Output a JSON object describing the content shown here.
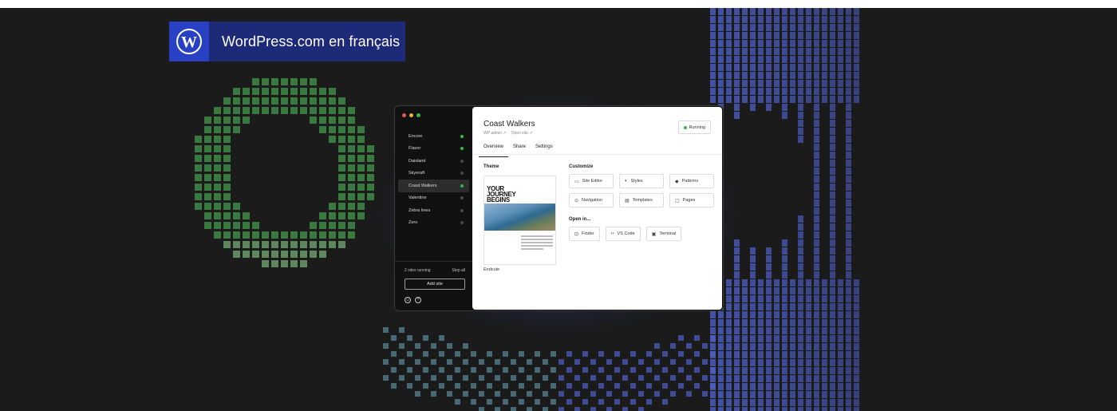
{
  "brand": {
    "title": "WordPress.com en français",
    "logo_icon": "wordpress-logo-icon",
    "bg_color": "#1c2a78",
    "logo_bg_color": "#2740c4"
  },
  "app": {
    "window_dots": [
      "#e25c4a",
      "#f0b429",
      "#2fba4a"
    ],
    "sidebar": {
      "items": [
        {
          "label": "Encore",
          "running": true,
          "active": false
        },
        {
          "label": "Flavor",
          "running": true,
          "active": false
        },
        {
          "label": "Daisland",
          "running": false,
          "active": false
        },
        {
          "label": "Skyeraft",
          "running": false,
          "active": false
        },
        {
          "label": "Coast Walkers",
          "running": true,
          "active": true
        },
        {
          "label": "Valentine",
          "running": false,
          "active": false
        },
        {
          "label": "Zebra lines",
          "running": false,
          "active": false
        },
        {
          "label": "Zero",
          "running": false,
          "active": false
        }
      ],
      "running_text": "2 sites running",
      "stop_all_label": "Stop all",
      "add_site_label": "Add site",
      "bottom_icons": [
        "user-icon",
        "help-icon"
      ]
    },
    "main": {
      "site_title": "Coast Walkers",
      "links": [
        "WP admin ↗",
        "Open site ↗"
      ],
      "status_label": "Running",
      "tabs": [
        {
          "label": "Overview",
          "active": true
        },
        {
          "label": "Share",
          "active": false
        },
        {
          "label": "Settings",
          "active": false
        }
      ],
      "theme_section_title": "Theme",
      "theme_headline": "YOUR JOURNEY BEGINS",
      "theme_name": "Endcute",
      "customize_title": "Customize",
      "customize_buttons": [
        {
          "label": "Site Editor",
          "icon": "layout-icon",
          "glyph": "▭"
        },
        {
          "label": "Styles",
          "icon": "styles-icon",
          "glyph": "◐"
        },
        {
          "label": "Patterns",
          "icon": "patterns-icon",
          "glyph": "◆"
        },
        {
          "label": "Navigation",
          "icon": "navigation-icon",
          "glyph": "⊙"
        },
        {
          "label": "Templates",
          "icon": "templates-icon",
          "glyph": "▤"
        },
        {
          "label": "Pages",
          "icon": "pages-icon",
          "glyph": "▢"
        }
      ],
      "open_in_title": "Open in...",
      "open_in_buttons": [
        {
          "label": "Finder",
          "icon": "finder-icon",
          "glyph": "⊡"
        },
        {
          "label": "VS Code",
          "icon": "code-icon",
          "glyph": "‹›"
        },
        {
          "label": "Terminal",
          "icon": "terminal-icon",
          "glyph": "▣"
        }
      ]
    }
  },
  "colors": {
    "page_bg": "#1b1b1b",
    "green_art": "#3e8a45",
    "blue_art": "#4f61c9",
    "status_green": "#2fba4a"
  }
}
